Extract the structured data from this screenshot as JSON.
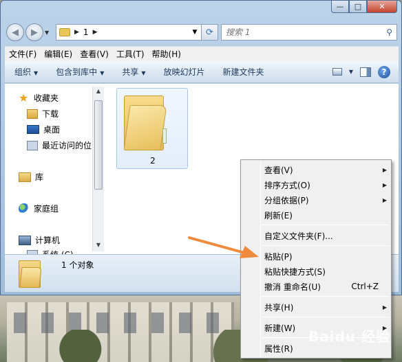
{
  "address": {
    "segment": "1"
  },
  "search": {
    "placeholder": "搜索 1"
  },
  "menubar": {
    "items": [
      "文件(F)",
      "编辑(E)",
      "查看(V)",
      "工具(T)",
      "帮助(H)"
    ]
  },
  "toolbar": {
    "organize": "组织",
    "include_in_library": "包含到库中",
    "share": "共享",
    "slideshow": "放映幻灯片",
    "new_folder": "新建文件夹"
  },
  "nav": {
    "favorites": "收藏夹",
    "downloads": "下载",
    "desktop": "桌面",
    "recent": "最近访问的位",
    "libraries": "库",
    "homegroup": "家庭组",
    "computer": "计算机",
    "partial": "系统 (C)"
  },
  "files": [
    {
      "name": "2",
      "type": "folder"
    }
  ],
  "details": {
    "summary": "1 个对象"
  },
  "context_menu": {
    "view": "查看(V)",
    "sort_by": "排序方式(O)",
    "group_by": "分组依据(P)",
    "refresh": "刷新(E)",
    "customize": "自定义文件夹(F)...",
    "paste": "粘贴(P)",
    "paste_shortcut": "粘贴快捷方式(S)",
    "undo_rename": "撤消 重命名(U)",
    "undo_shortcut": "Ctrl+Z",
    "share": "共享(H)",
    "new": "新建(W)",
    "properties": "属性(R)"
  },
  "watermark": "Baidu 经验",
  "colors": {
    "arrow": "#f08a3c",
    "toolbar_text": "#1e395b"
  }
}
